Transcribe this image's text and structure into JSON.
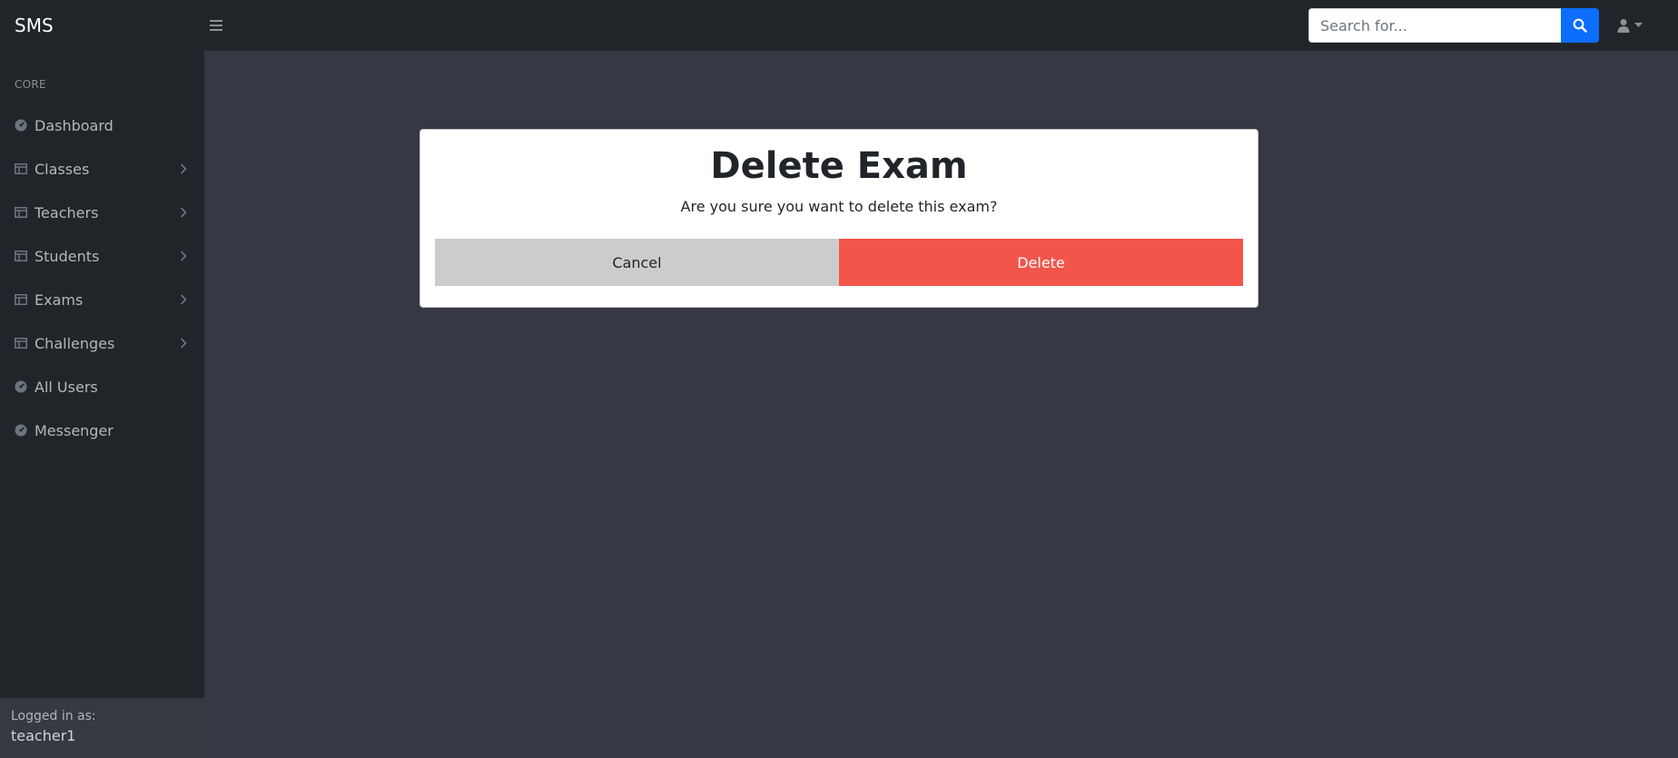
{
  "app": {
    "brand": "SMS"
  },
  "search": {
    "placeholder": "Search for..."
  },
  "sidebar": {
    "heading": "CORE",
    "items": [
      {
        "label": "Dashboard",
        "icon": "gauge-icon",
        "has_submenu": false
      },
      {
        "label": "Classes",
        "icon": "table-icon",
        "has_submenu": true
      },
      {
        "label": "Teachers",
        "icon": "table-icon",
        "has_submenu": true
      },
      {
        "label": "Students",
        "icon": "table-icon",
        "has_submenu": true
      },
      {
        "label": "Exams",
        "icon": "table-icon",
        "has_submenu": true
      },
      {
        "label": "Challenges",
        "icon": "table-icon",
        "has_submenu": true
      },
      {
        "label": "All Users",
        "icon": "gauge-icon",
        "has_submenu": false
      },
      {
        "label": "Messenger",
        "icon": "gauge-icon",
        "has_submenu": false
      }
    ],
    "footer": {
      "label": "Logged in as:",
      "user": "teacher1"
    }
  },
  "modal": {
    "title": "Delete Exam",
    "message": "Are you sure you want to delete this exam?",
    "cancel_label": "Cancel",
    "delete_label": "Delete"
  },
  "colors": {
    "topbar": "#212529",
    "sidebar": "#212529",
    "content_bg": "#363943",
    "primary": "#0d6efd",
    "danger": "#f2554a",
    "cancel": "#cccccc"
  }
}
